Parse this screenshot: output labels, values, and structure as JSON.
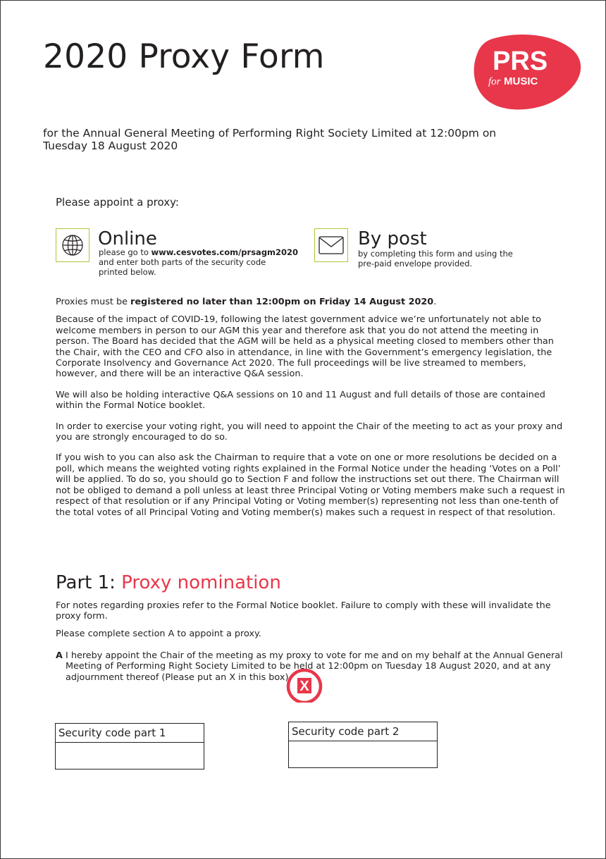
{
  "title": "2020 Proxy Form",
  "logo": {
    "main": "PRS",
    "for": "for",
    "music": "MUSIC",
    "brand_color": "#e8374a"
  },
  "subtitle": "for the Annual General Meeting of Performing Right Society Limited at 12:00pm on Tuesday 18 August 2020",
  "appoint_label": "Please appoint a proxy:",
  "methods": {
    "online": {
      "icon": "globe-icon",
      "title": "Online",
      "line_prefix": "please go to ",
      "url": "www.cesvotes.com/prsagm2020",
      "line_rest": "and enter both parts of the security code printed below."
    },
    "post": {
      "icon": "envelope-icon",
      "title": "By post",
      "text": "by completing this form and using the pre-paid envelope provided."
    }
  },
  "deadline": {
    "prefix": "Proxies must be ",
    "bold": "registered no later than 12:00pm on Friday 14 August 2020",
    "suffix": "."
  },
  "paragraphs": [
    "Because of the impact of COVID-19, following the latest government advice we’re unfortunately not able to welcome members in person to our AGM this year and therefore ask that you do not attend the meeting in person. The Board has decided that the AGM will be held as a physical meeting closed to members other than the Chair, with the CEO and CFO also in attendance, in line with the Government’s emergency legislation, the Corporate Insolvency and Governance Act 2020. The full proceedings will be live streamed to members, however, and there will be an interactive Q&A session.",
    "We will also be holding interactive Q&A sessions on 10 and 11 August and full details of those are contained within the Formal Notice booklet.",
    "In order to exercise your voting right, you will need to appoint the Chair of the meeting to act as your proxy and you are strongly encouraged to do so.",
    "If you wish to you can also ask the Chairman to require that a vote on one or more resolutions be decided on a poll, which means the weighted voting rights explained in the Formal Notice under the heading ‘Votes on a Poll’ will be applied. To do so, you should go to Section F and follow the instructions set out there. The Chairman will not be obliged to demand a poll unless at least three Principal Voting or Voting members make such a request in respect of that resolution or if any Principal Voting or Voting member(s) representing not less than one-tenth of the total votes of all Principal Voting and Voting member(s) makes such a request in respect of that resolution."
  ],
  "part1": {
    "prefix": "Part 1: ",
    "heading": "Proxy nomination",
    "notes": "For notes regarding proxies refer to the Formal Notice booklet. Failure to comply with these will invalidate the proxy form.",
    "instruction": "Please complete section A to appoint a proxy.",
    "section_a": {
      "letter": "A",
      "text": "I hereby appoint the Chair of the meeting as my proxy to vote for me and on my behalf at the Annual General Meeting of Performing Right Society Limited to be held at 12:00pm on Tuesday 18 August 2020, and at any adjournment thereof (Please put an X in this box).",
      "mark": "X"
    }
  },
  "security_codes": [
    {
      "label": "Security code part 1",
      "value": ""
    },
    {
      "label": "Security code part 2",
      "value": ""
    }
  ]
}
